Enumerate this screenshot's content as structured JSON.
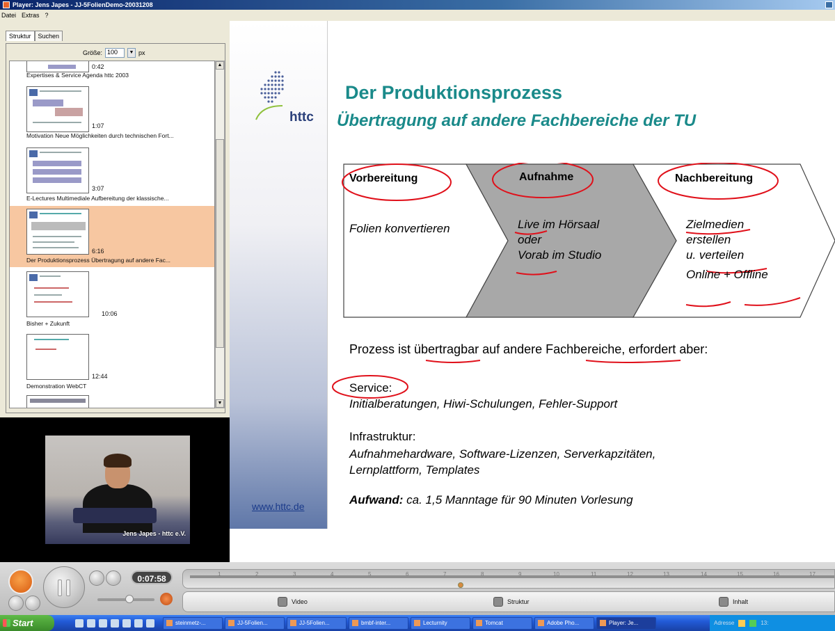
{
  "window": {
    "title": "Player: Jens Japes - JJ-5FolienDemo-20031208"
  },
  "menu": [
    "Datei",
    "Extras",
    "?"
  ],
  "left": {
    "tabs": [
      "Struktur",
      "Suchen"
    ],
    "size_label": "Größe:",
    "size_value": "100",
    "size_unit": "px",
    "entries": [
      {
        "time": "0:42",
        "label": "Expertises & Service Agenda httc 2003"
      },
      {
        "time": "1:07",
        "label": "Motivation Neue Möglichkeiten durch technischen Fort..."
      },
      {
        "time": "3:07",
        "label": "E-Lectures Multimediale Aufbereitung der klassische..."
      },
      {
        "time": "6:16",
        "label": "Der Produktionsprozess Übertragung auf andere Fac..."
      },
      {
        "time": "10:06",
        "label": "Bisher + Zukunft"
      },
      {
        "time": "12:44",
        "label": "Demonstration WebCT"
      }
    ],
    "selected_index": 3
  },
  "video": {
    "caption": "Jens Japes - httc e.V."
  },
  "slide": {
    "logo": "httc",
    "title": "Der Produktionsprozess",
    "subtitle": "Übertragung auf andere Fachbereiche der TU",
    "phases": [
      {
        "label": "Vorbereitung",
        "lines": [
          "Folien konvertieren"
        ]
      },
      {
        "label": "Aufnahme",
        "lines": [
          "Live im Hörsaal",
          "oder",
          "Vorab im Studio"
        ]
      },
      {
        "label": "Nachbereitung",
        "lines": [
          "Zielmedien",
          "erstellen",
          "u. verteilen",
          "",
          "Online + Offline"
        ]
      }
    ],
    "main_statement": "Prozess ist übertragbar auf andere Fachbereiche, erfordert aber:",
    "service_label": "Service:",
    "service_text": "Initialberatungen, Hiwi-Schulungen, Fehler-Support",
    "infra_label": "Infrastruktur:",
    "infra_line1": "Aufnahmehardware, Software-Lizenzen, Serverkapzitäten,",
    "infra_line2": "Lernplattform, Templates",
    "effort_label": "Aufwand:",
    "effort_text": " ca. 1,5 Manntage für 90 Minuten Vorlesung",
    "website": "www.httc.de"
  },
  "controls": {
    "current_time": "0:07:58",
    "timeline_ticks": [
      "1",
      "2",
      "3",
      "4",
      "5",
      "6",
      "7",
      "8",
      "9",
      "10",
      "11",
      "12",
      "13",
      "14",
      "15",
      "16",
      "17"
    ],
    "playhead_fraction": 0.42,
    "tabs": [
      "Video",
      "Struktur",
      "Inhalt"
    ]
  },
  "taskbar": {
    "start": "Start",
    "tasks": [
      "steinmetz-...",
      "JJ-5Folien...",
      "JJ-5Folien...",
      "bmbf-inter...",
      "Lecturnity",
      "Tomcat",
      "Adobe Pho...",
      "Player: Je..."
    ],
    "active_task": 7,
    "tray_text": "Adresse",
    "clock": "13:"
  },
  "colors": {
    "accent": "#1a8a8a",
    "selection": "#f7c7a1",
    "annotation": "#e0101a"
  }
}
